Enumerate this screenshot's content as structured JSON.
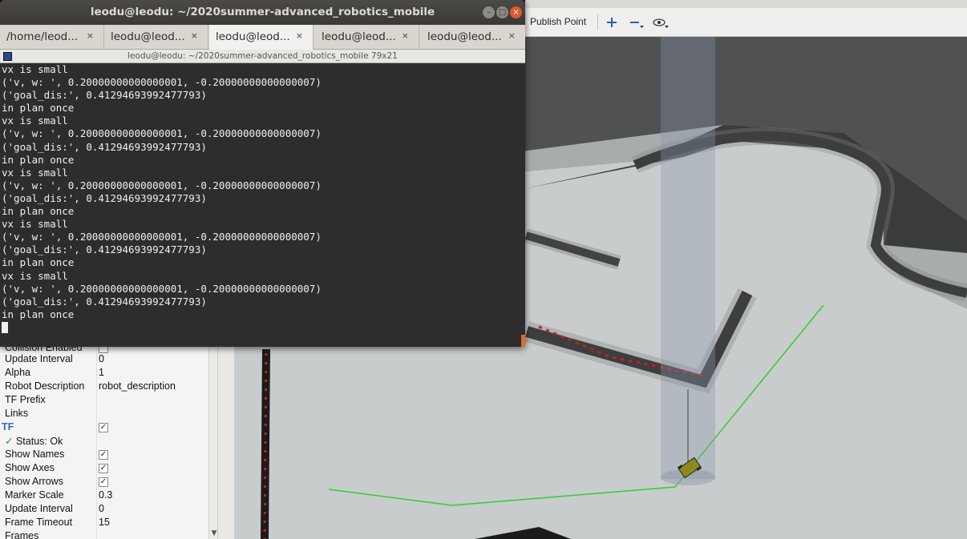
{
  "rviz": {
    "toolbar": {
      "publish_point_label": "Publish Point",
      "move_camera_icon": "plus-move-icon",
      "minus_icon": "minus-icon",
      "eye_icon": "eye-icon"
    },
    "displays_panel": {
      "rows": [
        {
          "key": "Collision Enabled",
          "value": "",
          "checkbox": "unchecked"
        },
        {
          "key": "Update Interval",
          "value": "0"
        },
        {
          "key": "Alpha",
          "value": "1"
        },
        {
          "key": "Robot Description",
          "value": "robot_description"
        },
        {
          "key": "TF Prefix",
          "value": ""
        },
        {
          "key": "Links",
          "value": ""
        },
        {
          "key": "TF",
          "value": "",
          "checkbox": "checked"
        },
        {
          "key": "Status: Ok",
          "value": ""
        },
        {
          "key": "Show Names",
          "value": "",
          "checkbox": "checked"
        },
        {
          "key": "Show Axes",
          "value": "",
          "checkbox": "checked"
        },
        {
          "key": "Show Arrows",
          "value": "",
          "checkbox": "checked"
        },
        {
          "key": "Marker Scale",
          "value": "0.3"
        },
        {
          "key": "Update Interval",
          "value": "0"
        },
        {
          "key": "Frame Timeout",
          "value": "15"
        },
        {
          "key": "Frames",
          "value": ""
        }
      ],
      "tf_color": "#2a6fc9",
      "status_ok_color": "#2e8b2e"
    },
    "colors": {
      "floor": "#c8cbcb",
      "obstacle": "#1a1a1a",
      "inflation": "#7a8080",
      "path": "#33cc33",
      "laser": "#d41a1a",
      "robot": "#8c8a1e"
    }
  },
  "terminal": {
    "window_title": "leodu@leodu: ~/2020summer-advanced_robotics_mobile",
    "tabs": [
      {
        "label": "/home/leod...",
        "close": "×",
        "active": false
      },
      {
        "label": "leodu@leod...",
        "close": "×",
        "active": false
      },
      {
        "label": "leodu@leod...",
        "close": "×",
        "active": true
      },
      {
        "label": "leodu@leod...",
        "close": "×",
        "active": false
      },
      {
        "label": "leodu@leod...",
        "close": "×",
        "active": false
      }
    ],
    "subtitle": "leodu@leodu: ~/2020summer-advanced_robotics_mobile 79x21",
    "lines": [
      "vx is small",
      "('v, w: ', 0.20000000000000001, -0.20000000000000007)",
      "('goal_dis:', 0.41294693992477793)",
      "in plan once",
      "vx is small",
      "('v, w: ', 0.20000000000000001, -0.20000000000000007)",
      "('goal_dis:', 0.41294693992477793)",
      "in plan once",
      "vx is small",
      "('v, w: ', 0.20000000000000001, -0.20000000000000007)",
      "('goal_dis:', 0.41294693992477793)",
      "in plan once",
      "vx is small",
      "('v, w: ', 0.20000000000000001, -0.20000000000000007)",
      "('goal_dis:', 0.41294693992477793)",
      "in plan once",
      "vx is small",
      "('v, w: ', 0.20000000000000001, -0.20000000000000007)",
      "('goal_dis:', 0.41294693992477793)",
      "in plan once"
    ]
  }
}
